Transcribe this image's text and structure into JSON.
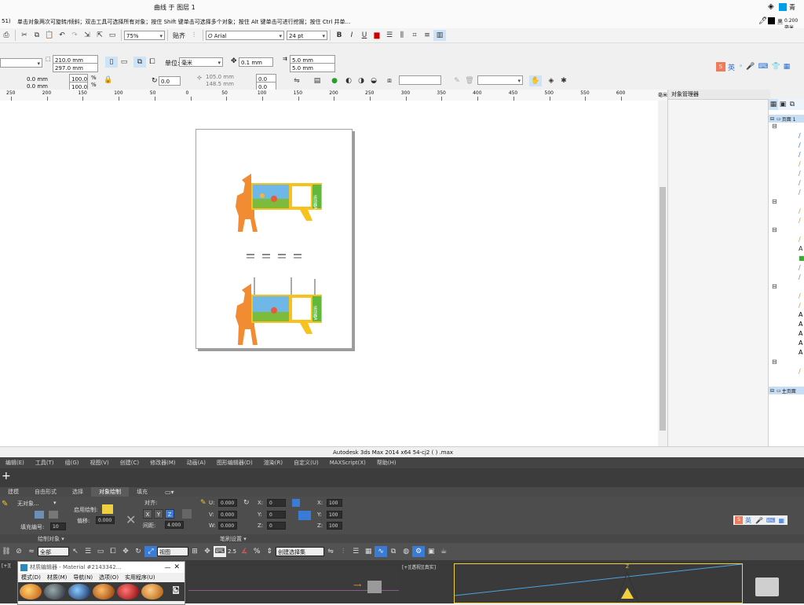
{
  "corel": {
    "title_left": "",
    "doc_title": "曲线 于 图层 1",
    "fill_label": "青",
    "outline_label": "黑",
    "outline_width": "0.200 毫米",
    "hint_prefix": "51)",
    "hint": "单击对象两次可旋转/倾斜；双击工具可选择所有对象；按住 Shift 键单击可选择多个对象；按住 Alt 键单击可进行挖掘；按住 Ctrl 并单...",
    "toolbar": {
      "zoom": "75%",
      "snap_label": "贴齐",
      "font_name": "Arial",
      "font_size": "24 pt"
    },
    "propbar1": {
      "width": "210.0 mm",
      "height": "297.0 mm",
      "unit_label": "单位:",
      "unit_value": "毫米",
      "nudge": "0.1 mm",
      "dup_x": "5.0 mm",
      "dup_y": "5.0 mm"
    },
    "propbar2": {
      "pos_x": "0.0 mm",
      "pos_y": "0.0 mm",
      "scale_x": "100.0",
      "scale_y": "100.0",
      "pct": "%",
      "rotate": "0.0",
      "center_x": "105.0 mm",
      "center_y": "148.5 mm",
      "skew_x": "0.0",
      "skew_y": "0.0"
    },
    "ruler_ticks": [
      "250",
      "200",
      "150",
      "100",
      "50",
      "0",
      "50",
      "100",
      "150",
      "200",
      "250",
      "300",
      "350",
      "400",
      "450",
      "500",
      "550",
      "600"
    ],
    "ruler_unit": "毫米",
    "object_manager_title": "对象管理器",
    "layers": {
      "page1": "页面 1",
      "master": "主页面"
    },
    "design_labels": [
      "运动器A",
      "运动器A"
    ],
    "ime_text": "英"
  },
  "max": {
    "window_caption": "Autodesk 3ds Max  2014 x64       54-cj2 ( ) .max",
    "menus": [
      "编辑(E)",
      "工具(T)",
      "组(G)",
      "视图(V)",
      "创建(C)",
      "修改器(M)",
      "动画(A)",
      "图形编辑器(D)",
      "渲染(R)",
      "自定义(U)",
      "MAXScript(X)",
      "帮助(H)"
    ],
    "ribbon_tabs": [
      "建模",
      "自由形式",
      "选择",
      "对象绘制",
      "填充"
    ],
    "ribbon": {
      "no_object": "无对象...",
      "fill_number_label": "填充编号:",
      "fill_number": "10",
      "enable_paint": "启用绘制:",
      "offset_label": "偏移:",
      "offset_value": "0.000",
      "align_label": "对齐:",
      "axes": [
        "X",
        "Y",
        "Z"
      ],
      "spacing_label": "间距:",
      "spacing_value": "4.000",
      "u_label": "U:",
      "u_value": "0.000",
      "v_label": "V:",
      "v_value": "0.000",
      "w_label": "W:",
      "w_value": "0.000",
      "x_label": "X:",
      "x_value": "0",
      "y_label": "Y:",
      "y_value": "0",
      "z_label": "Z:",
      "z_value": "0",
      "sx_label": "X:",
      "sx_value": "100",
      "sy_label": "Y:",
      "sy_value": "100",
      "sz_label": "Z:",
      "sz_value": "100"
    },
    "ribbon_groups": [
      "绘制对象",
      "笔刷设置"
    ],
    "maintool": {
      "filter": "全部",
      "ref_coord": "视图",
      "snap_value": "2.5",
      "selection_set": "创建选择集"
    },
    "material_editor": {
      "title": "材质编辑器 - Material #2143342...",
      "menus": [
        "模式(D)",
        "材质(M)",
        "导航(N)",
        "选项(O)",
        "实用程序(U)"
      ]
    },
    "viewport_label": "[+][透视][真实]",
    "viewport_label_left": "[+][",
    "ime_text": "英"
  }
}
